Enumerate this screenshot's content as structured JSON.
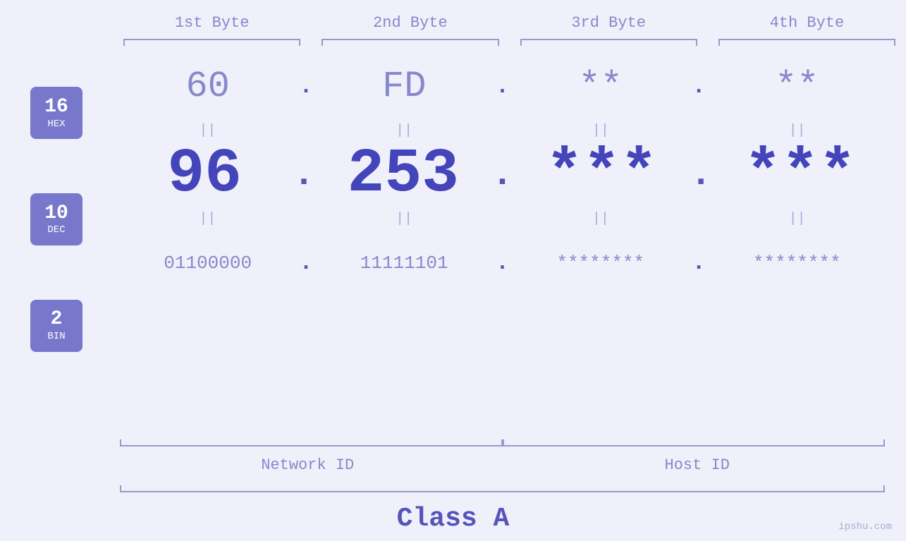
{
  "headers": {
    "byte1": "1st Byte",
    "byte2": "2nd Byte",
    "byte3": "3rd Byte",
    "byte4": "4th Byte"
  },
  "badges": {
    "hex": {
      "number": "16",
      "label": "HEX"
    },
    "dec": {
      "number": "10",
      "label": "DEC"
    },
    "bin": {
      "number": "2",
      "label": "BIN"
    }
  },
  "hex_row": {
    "b1": "60",
    "b2": "FD",
    "b3": "**",
    "b4": "**",
    "dots": [
      ".",
      ".",
      ".",
      "."
    ]
  },
  "dec_row": {
    "b1": "96",
    "b2": "253",
    "b3": "***",
    "b4": "***",
    "dots": [
      ".",
      ".",
      ".",
      "."
    ]
  },
  "bin_row": {
    "b1": "01100000",
    "b2": "11111101",
    "b3": "********",
    "b4": "********",
    "dots": [
      ".",
      ".",
      ".",
      "."
    ]
  },
  "labels": {
    "network_id": "Network ID",
    "host_id": "Host ID",
    "class": "Class A"
  },
  "watermark": "ipshu.com",
  "equals": "||"
}
